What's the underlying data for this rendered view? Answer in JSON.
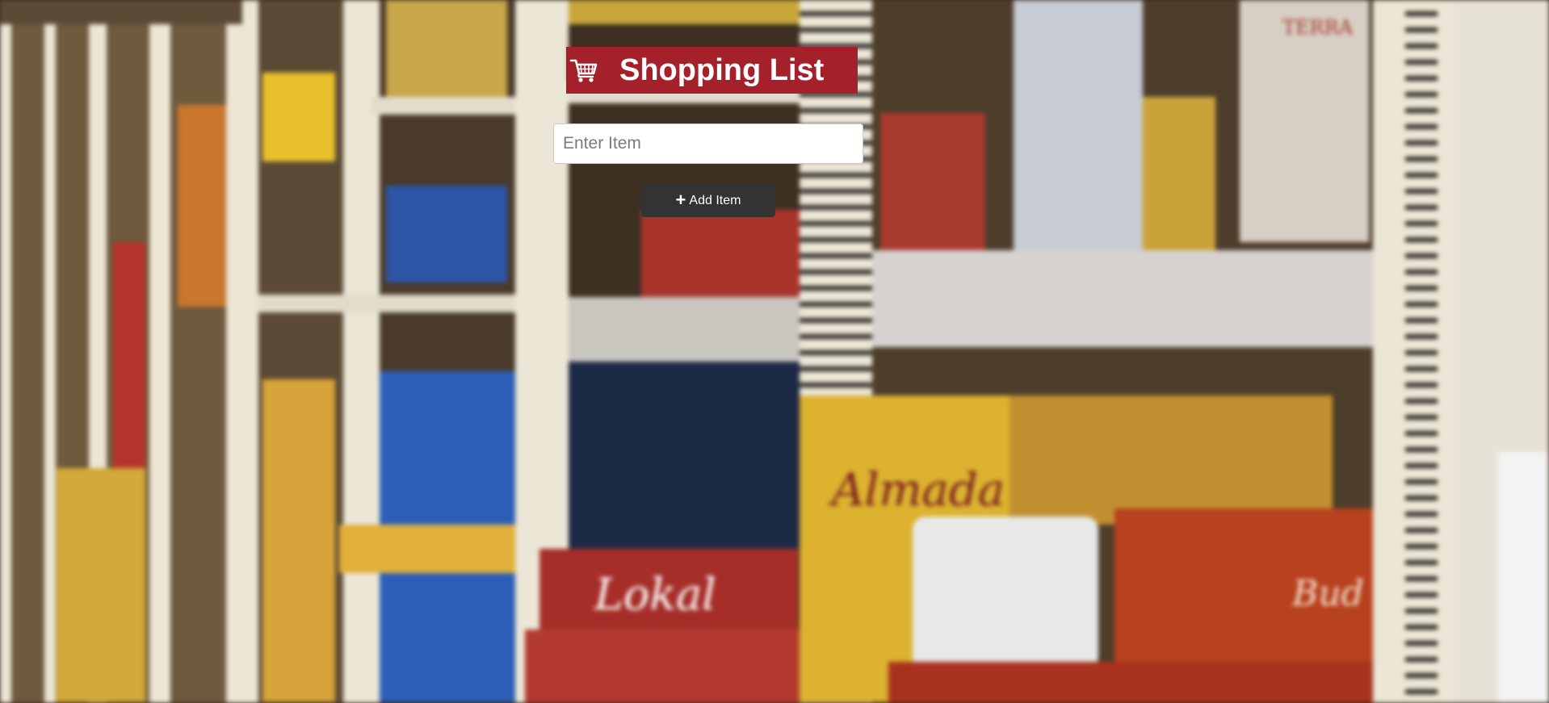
{
  "header": {
    "title": "Shopping List",
    "icon": "shopping-cart-icon",
    "background_color": "#a4202a"
  },
  "form": {
    "item_placeholder": "Enter Item",
    "item_value": "",
    "add_icon": "plus-icon",
    "add_label": "Add Item",
    "button_color": "#333333"
  },
  "background": {
    "description_icon": "warehouse-shelves-image",
    "package_labels": [
      "Almada",
      "Lokal",
      "Bud",
      "TERRA"
    ]
  }
}
